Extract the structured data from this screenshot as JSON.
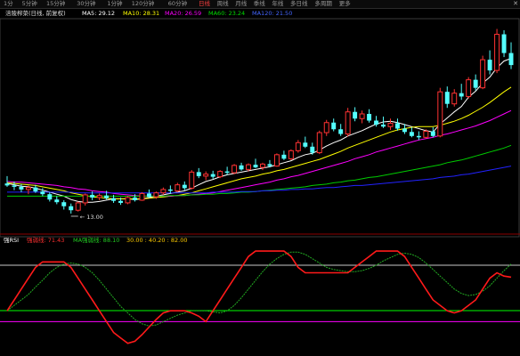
{
  "toolbar": {
    "items": [
      "1分",
      "5分钟",
      "15分钟",
      "30分钟",
      "1分钟",
      "120分钟",
      "60分钟",
      "日线",
      "周线",
      "月线",
      "季线",
      "年线",
      "多日线",
      "多周期",
      "更多"
    ],
    "active_index": 7,
    "close_label": "✕"
  },
  "main_legend": {
    "title": "涪陵榨菜(日线, 前复权)",
    "ma5": "MA5: 29.12",
    "ma10": "MA10: 28.31",
    "ma20": "MA20: 26.59",
    "ma60": "MA60: 23.24",
    "ma120": "MA120: 21.50"
  },
  "indicator_legend": {
    "name": "强RSI",
    "value1": "强弱线: 71.43",
    "value2": "MA强弱线: 88.10",
    "levels": "30.00 : 40.20 : 82.00"
  },
  "colors": {
    "up": "#ff3232",
    "down": "#54ffff",
    "ma5": "#ffffff",
    "ma10": "#ffff00",
    "ma20": "#ff00ff",
    "ma60": "#00cc00",
    "ma120": "#2222ff",
    "rsi": "#ff1a1a",
    "rsi_ma": "#22aa22",
    "level_high": "#c8c8c8",
    "level_mid": "#00ff00",
    "level_low": "#ff00ff"
  },
  "chart_data": [
    {
      "type": "candlestick",
      "title": "涪陵榨菜(日线, 前复权)",
      "low_annotation": "13.00",
      "ylim": [
        11.0,
        42.0
      ],
      "candles": [
        {
          "o": 17.5,
          "h": 18.6,
          "l": 17.0,
          "c": 17.2
        },
        {
          "o": 17.2,
          "h": 17.8,
          "l": 16.5,
          "c": 17.0
        },
        {
          "o": 17.0,
          "h": 17.4,
          "l": 16.2,
          "c": 16.6
        },
        {
          "o": 16.6,
          "h": 17.2,
          "l": 15.9,
          "c": 16.9
        },
        {
          "o": 16.9,
          "h": 17.3,
          "l": 16.1,
          "c": 16.3
        },
        {
          "o": 16.3,
          "h": 16.8,
          "l": 15.6,
          "c": 15.9
        },
        {
          "o": 15.9,
          "h": 16.2,
          "l": 14.8,
          "c": 15.1
        },
        {
          "o": 15.1,
          "h": 15.6,
          "l": 14.4,
          "c": 14.7
        },
        {
          "o": 14.7,
          "h": 15.0,
          "l": 13.6,
          "c": 14.1
        },
        {
          "o": 14.1,
          "h": 14.5,
          "l": 13.0,
          "c": 13.5
        },
        {
          "o": 13.5,
          "h": 14.8,
          "l": 13.3,
          "c": 14.6
        },
        {
          "o": 14.6,
          "h": 16.0,
          "l": 14.2,
          "c": 15.8
        },
        {
          "o": 15.8,
          "h": 16.3,
          "l": 15.0,
          "c": 15.4
        },
        {
          "o": 15.4,
          "h": 16.0,
          "l": 15.0,
          "c": 15.7
        },
        {
          "o": 15.7,
          "h": 16.4,
          "l": 15.1,
          "c": 15.3
        },
        {
          "o": 15.3,
          "h": 15.8,
          "l": 14.6,
          "c": 14.9
        },
        {
          "o": 14.9,
          "h": 15.4,
          "l": 14.3,
          "c": 14.6
        },
        {
          "o": 14.6,
          "h": 15.6,
          "l": 14.4,
          "c": 15.4
        },
        {
          "o": 15.4,
          "h": 15.9,
          "l": 14.8,
          "c": 15.0
        },
        {
          "o": 15.0,
          "h": 16.2,
          "l": 14.9,
          "c": 16.0
        },
        {
          "o": 16.0,
          "h": 16.6,
          "l": 15.3,
          "c": 15.5
        },
        {
          "o": 15.5,
          "h": 16.3,
          "l": 15.2,
          "c": 16.1
        },
        {
          "o": 16.1,
          "h": 16.9,
          "l": 15.8,
          "c": 16.6
        },
        {
          "o": 16.6,
          "h": 17.2,
          "l": 16.0,
          "c": 16.4
        },
        {
          "o": 16.4,
          "h": 17.6,
          "l": 16.2,
          "c": 17.3
        },
        {
          "o": 17.3,
          "h": 17.8,
          "l": 16.5,
          "c": 16.8
        },
        {
          "o": 16.8,
          "h": 19.5,
          "l": 16.6,
          "c": 19.2
        },
        {
          "o": 19.2,
          "h": 19.8,
          "l": 18.3,
          "c": 18.6
        },
        {
          "o": 18.6,
          "h": 19.3,
          "l": 18.0,
          "c": 18.9
        },
        {
          "o": 18.9,
          "h": 19.4,
          "l": 18.2,
          "c": 18.5
        },
        {
          "o": 18.5,
          "h": 19.5,
          "l": 18.3,
          "c": 19.3
        },
        {
          "o": 19.3,
          "h": 20.0,
          "l": 18.8,
          "c": 19.1
        },
        {
          "o": 19.1,
          "h": 20.4,
          "l": 18.9,
          "c": 20.2
        },
        {
          "o": 20.2,
          "h": 20.6,
          "l": 19.4,
          "c": 19.6
        },
        {
          "o": 19.6,
          "h": 20.5,
          "l": 19.3,
          "c": 20.3
        },
        {
          "o": 20.3,
          "h": 21.2,
          "l": 19.8,
          "c": 19.9
        },
        {
          "o": 19.9,
          "h": 20.6,
          "l": 19.5,
          "c": 20.4
        },
        {
          "o": 20.4,
          "h": 21.0,
          "l": 19.9,
          "c": 20.1
        },
        {
          "o": 20.1,
          "h": 22.0,
          "l": 20.0,
          "c": 21.8
        },
        {
          "o": 21.8,
          "h": 22.4,
          "l": 21.0,
          "c": 21.2
        },
        {
          "o": 21.2,
          "h": 22.6,
          "l": 21.0,
          "c": 22.4
        },
        {
          "o": 22.4,
          "h": 24.0,
          "l": 22.1,
          "c": 23.6
        },
        {
          "o": 23.6,
          "h": 24.5,
          "l": 22.8,
          "c": 23.0
        },
        {
          "o": 23.0,
          "h": 23.6,
          "l": 21.8,
          "c": 22.1
        },
        {
          "o": 22.1,
          "h": 25.4,
          "l": 21.9,
          "c": 25.1
        },
        {
          "o": 25.1,
          "h": 27.0,
          "l": 24.6,
          "c": 26.6
        },
        {
          "o": 26.6,
          "h": 27.2,
          "l": 25.3,
          "c": 25.6
        },
        {
          "o": 25.6,
          "h": 26.4,
          "l": 24.6,
          "c": 24.9
        },
        {
          "o": 24.9,
          "h": 28.8,
          "l": 24.5,
          "c": 28.2
        },
        {
          "o": 28.2,
          "h": 28.9,
          "l": 26.8,
          "c": 27.2
        },
        {
          "o": 27.2,
          "h": 28.4,
          "l": 26.5,
          "c": 27.9
        },
        {
          "o": 27.9,
          "h": 28.6,
          "l": 26.6,
          "c": 26.9
        },
        {
          "o": 26.9,
          "h": 27.6,
          "l": 26.0,
          "c": 26.3
        },
        {
          "o": 26.3,
          "h": 27.5,
          "l": 25.8,
          "c": 26.0
        },
        {
          "o": 26.0,
          "h": 27.2,
          "l": 25.5,
          "c": 26.5
        },
        {
          "o": 26.5,
          "h": 27.2,
          "l": 25.4,
          "c": 25.7
        },
        {
          "o": 25.7,
          "h": 26.4,
          "l": 24.9,
          "c": 25.2
        },
        {
          "o": 25.2,
          "h": 25.9,
          "l": 24.4,
          "c": 24.6
        },
        {
          "o": 24.6,
          "h": 25.3,
          "l": 24.0,
          "c": 24.4
        },
        {
          "o": 24.4,
          "h": 25.6,
          "l": 24.2,
          "c": 25.3
        },
        {
          "o": 25.3,
          "h": 25.9,
          "l": 24.4,
          "c": 24.6
        },
        {
          "o": 24.6,
          "h": 31.8,
          "l": 24.4,
          "c": 31.2
        },
        {
          "o": 31.2,
          "h": 32.0,
          "l": 28.8,
          "c": 29.4
        },
        {
          "o": 29.4,
          "h": 31.6,
          "l": 29.0,
          "c": 31.0
        },
        {
          "o": 31.0,
          "h": 32.4,
          "l": 30.0,
          "c": 30.5
        },
        {
          "o": 30.5,
          "h": 33.4,
          "l": 30.2,
          "c": 33.0
        },
        {
          "o": 33.0,
          "h": 33.8,
          "l": 31.4,
          "c": 31.8
        },
        {
          "o": 31.8,
          "h": 36.6,
          "l": 31.6,
          "c": 36.0
        },
        {
          "o": 36.0,
          "h": 37.4,
          "l": 33.8,
          "c": 34.4
        },
        {
          "o": 34.4,
          "h": 40.6,
          "l": 34.0,
          "c": 39.8
        },
        {
          "o": 39.8,
          "h": 40.4,
          "l": 36.4,
          "c": 37.0
        },
        {
          "o": 37.0,
          "h": 38.6,
          "l": 34.6,
          "c": 35.2
        }
      ],
      "ma_series": [
        {
          "name": "MA5",
          "values": [
            17.5,
            17.3,
            17.1,
            17.0,
            16.8,
            16.5,
            16.2,
            15.9,
            15.6,
            15.1,
            14.8,
            14.7,
            14.7,
            14.8,
            15.0,
            15.2,
            15.2,
            15.2,
            15.1,
            15.2,
            15.4,
            15.6,
            15.8,
            16.0,
            16.2,
            16.4,
            16.8,
            17.3,
            17.8,
            18.1,
            18.5,
            18.8,
            19.0,
            19.2,
            19.4,
            19.6,
            19.8,
            20.0,
            20.3,
            20.6,
            20.9,
            21.4,
            21.8,
            22.0,
            22.5,
            23.1,
            23.6,
            24.0,
            24.6,
            25.0,
            25.4,
            25.9,
            26.4,
            26.7,
            26.8,
            26.6,
            26.3,
            26.0,
            25.7,
            25.4,
            25.2,
            26.4,
            27.3,
            28.2,
            29.0,
            30.4,
            31.3,
            32.5,
            33.4,
            34.8,
            35.8,
            36.2
          ]
        },
        {
          "name": "MA10",
          "values": [
            17.6,
            17.5,
            17.4,
            17.3,
            17.2,
            17.0,
            16.8,
            16.6,
            16.4,
            16.1,
            15.9,
            15.7,
            15.5,
            15.4,
            15.3,
            15.2,
            15.2,
            15.2,
            15.2,
            15.2,
            15.3,
            15.4,
            15.5,
            15.6,
            15.7,
            15.9,
            16.1,
            16.4,
            16.7,
            17.0,
            17.3,
            17.6,
            17.9,
            18.2,
            18.4,
            18.6,
            18.9,
            19.1,
            19.4,
            19.6,
            19.9,
            20.2,
            20.5,
            20.8,
            21.1,
            21.5,
            21.9,
            22.3,
            22.8,
            23.2,
            23.6,
            24.0,
            24.4,
            24.8,
            25.2,
            25.5,
            25.7,
            25.9,
            26.0,
            26.0,
            26.0,
            26.2,
            26.5,
            26.8,
            27.2,
            27.7,
            28.3,
            28.9,
            29.6,
            30.4,
            31.2,
            31.9
          ]
        },
        {
          "name": "MA20",
          "values": [
            17.8,
            17.7,
            17.7,
            17.6,
            17.5,
            17.4,
            17.3,
            17.2,
            17.0,
            16.9,
            16.7,
            16.6,
            16.4,
            16.3,
            16.2,
            16.0,
            15.9,
            15.8,
            15.7,
            15.6,
            15.6,
            15.6,
            15.6,
            15.6,
            15.7,
            15.7,
            15.8,
            15.9,
            16.0,
            16.1,
            16.3,
            16.5,
            16.7,
            16.9,
            17.1,
            17.3,
            17.5,
            17.7,
            18.0,
            18.2,
            18.5,
            18.7,
            19.0,
            19.3,
            19.6,
            19.9,
            20.2,
            20.5,
            20.8,
            21.2,
            21.5,
            21.8,
            22.2,
            22.5,
            22.8,
            23.1,
            23.4,
            23.7,
            24.0,
            24.2,
            24.4,
            24.7,
            24.9,
            25.2,
            25.5,
            25.8,
            26.1,
            26.5,
            26.9,
            27.4,
            27.9,
            28.4
          ]
        },
        {
          "name": "MA60",
          "values": [
            15.6,
            15.6,
            15.6,
            15.6,
            15.6,
            15.6,
            15.6,
            15.6,
            15.6,
            15.6,
            15.6,
            15.6,
            15.6,
            15.6,
            15.6,
            15.6,
            15.6,
            15.6,
            15.6,
            15.6,
            15.6,
            15.6,
            15.6,
            15.7,
            15.7,
            15.7,
            15.8,
            15.8,
            15.9,
            15.9,
            16.0,
            16.0,
            16.1,
            16.2,
            16.2,
            16.3,
            16.4,
            16.5,
            16.6,
            16.7,
            16.8,
            16.9,
            17.0,
            17.2,
            17.3,
            17.4,
            17.6,
            17.7,
            17.9,
            18.0,
            18.2,
            18.4,
            18.5,
            18.7,
            18.9,
            19.1,
            19.3,
            19.5,
            19.7,
            19.9,
            20.1,
            20.3,
            20.6,
            20.8,
            21.0,
            21.3,
            21.6,
            21.9,
            22.2,
            22.5,
            22.8,
            23.2
          ]
        },
        {
          "name": "MA120",
          "values": [
            16.2,
            16.2,
            16.2,
            16.2,
            16.2,
            16.2,
            16.2,
            16.2,
            16.2,
            16.2,
            16.1,
            16.1,
            16.1,
            16.1,
            16.1,
            16.1,
            16.1,
            16.1,
            16.1,
            16.1,
            16.1,
            16.1,
            16.1,
            16.1,
            16.1,
            16.1,
            16.1,
            16.1,
            16.1,
            16.2,
            16.2,
            16.2,
            16.2,
            16.3,
            16.3,
            16.3,
            16.4,
            16.4,
            16.5,
            16.5,
            16.6,
            16.6,
            16.7,
            16.7,
            16.8,
            16.9,
            16.9,
            17.0,
            17.1,
            17.2,
            17.2,
            17.3,
            17.4,
            17.5,
            17.6,
            17.7,
            17.8,
            17.9,
            18.0,
            18.1,
            18.2,
            18.4,
            18.5,
            18.6,
            18.8,
            18.9,
            19.1,
            19.3,
            19.5,
            19.7,
            19.9,
            20.1
          ]
        }
      ]
    },
    {
      "type": "line",
      "title": "强RSI",
      "ylim": [
        0,
        100
      ],
      "levels": [
        82.0,
        40.2,
        30.0
      ],
      "series": [
        {
          "name": "强弱线",
          "values": [
            40,
            50,
            60,
            70,
            80,
            85,
            85,
            85,
            85,
            80,
            70,
            60,
            50,
            40,
            30,
            20,
            15,
            10,
            12,
            18,
            25,
            32,
            38,
            40,
            40,
            40,
            38,
            35,
            30,
            40,
            50,
            60,
            70,
            80,
            90,
            95,
            95,
            95,
            95,
            95,
            90,
            80,
            75,
            75,
            75,
            75,
            75,
            75,
            75,
            80,
            85,
            90,
            95,
            95,
            95,
            95,
            90,
            80,
            70,
            60,
            50,
            45,
            40,
            38,
            40,
            45,
            50,
            60,
            70,
            75,
            72,
            71
          ]
        },
        {
          "name": "MA强弱线",
          "values": [
            40,
            45,
            50,
            55,
            62,
            68,
            75,
            80,
            83,
            84,
            83,
            80,
            75,
            68,
            60,
            52,
            44,
            38,
            32,
            28,
            26,
            27,
            30,
            33,
            36,
            38,
            40,
            40,
            40,
            39,
            38,
            40,
            45,
            52,
            60,
            68,
            76,
            83,
            88,
            92,
            94,
            94,
            92,
            88,
            84,
            80,
            78,
            77,
            76,
            76,
            77,
            79,
            82,
            86,
            89,
            92,
            93,
            92,
            89,
            84,
            78,
            72,
            66,
            60,
            56,
            54,
            55,
            58,
            63,
            70,
            77,
            83
          ]
        }
      ]
    }
  ]
}
